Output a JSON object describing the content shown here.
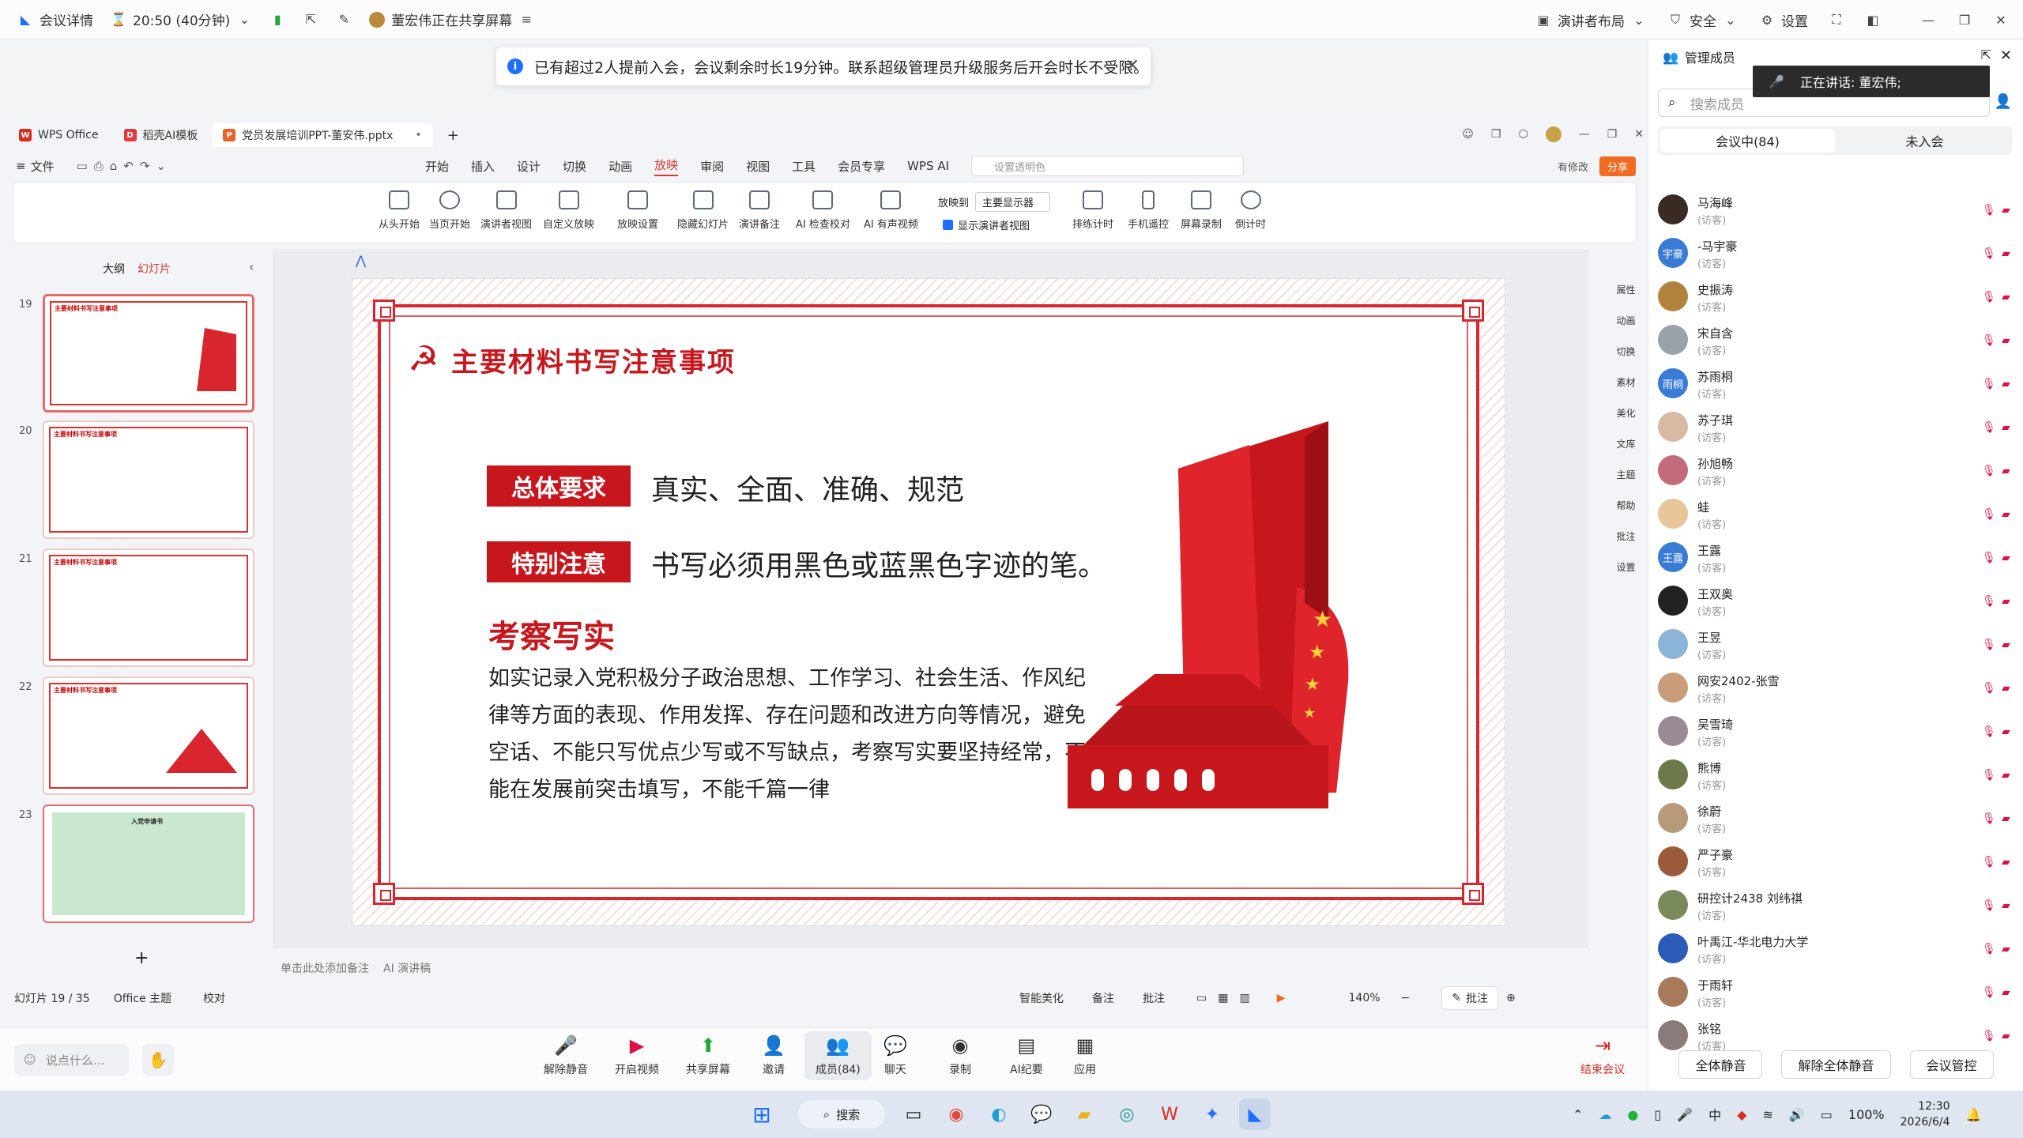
{
  "topbar": {
    "meeting_details": "会议详情",
    "timer": "20:50 (40分钟)",
    "sharing": "董宏伟正在共享屏幕",
    "presenter_layout": "演讲者布局",
    "security": "安全",
    "settings": "设置"
  },
  "notice": "已有超过2人提前入会，会议剩余时长19分钟。联系超级管理员升级服务后开会时长不受限。",
  "wps": {
    "tabs": [
      "WPS Office",
      "稻壳AI模板",
      "党员发展培训PPT-董安伟.pptx"
    ],
    "menu": [
      "开始",
      "插入",
      "设计",
      "切换",
      "动画",
      "放映",
      "审阅",
      "视图",
      "工具",
      "会员专享",
      "WPS AI"
    ],
    "active_menu": "放映",
    "file": "文件",
    "search_placeholder": "设置透明色",
    "edit_status": "有修改",
    "share": "分享",
    "ribbon": [
      "从头开始",
      "当页开始",
      "演讲者视图",
      "自定义放映",
      "放映设置",
      "隐藏幻灯片",
      "演讲备注",
      "AI 检查校对",
      "AI 有声视频",
      "排练计时",
      "手机遥控",
      "屏幕录制",
      "倒计时"
    ],
    "play_to": "放映到",
    "monitor": "主要显示器",
    "show_presenter": "显示演讲者视图",
    "outline": "大纲",
    "slides_tab": "幻灯片",
    "side_tools": [
      "属性",
      "动画",
      "切换",
      "素材",
      "美化",
      "文库",
      "主题",
      "帮助",
      "批注",
      "设置"
    ]
  },
  "thumbnails": [
    {
      "num": "19",
      "title": "主要材料书写注意事项"
    },
    {
      "num": "20",
      "title": "主要材料书写注意事项"
    },
    {
      "num": "21",
      "title": "主要材料书写注意事项"
    },
    {
      "num": "22",
      "title": "主要材料书写注意事项"
    },
    {
      "num": "23",
      "title": "入党申请书"
    }
  ],
  "slide": {
    "title": "主要材料书写注意事项",
    "tag1": "总体要求",
    "text1": "真实、全面、准确、规范",
    "tag2": "特别注意",
    "text2": "书写必须用黑色或蓝黑色字迹的笔。",
    "subtitle": "考察写实",
    "body": "如实记录入党积极分子政治思想、工作学习、社会生活、作风纪律等方面的表现、作用发挥、存在问题和改进方向等情况，避免空话、不能只写优点少写或不写缺点，考察写实要坚持经常，不能在发展前突击填写，不能千篇一律"
  },
  "notes": {
    "placeholder": "单击此处添加备注",
    "ai": "AI 演讲稿"
  },
  "status": {
    "slide": "幻灯片 19 / 35",
    "theme": "Office 主题",
    "proof": "校对",
    "beautify": "智能美化",
    "notes": "备注",
    "comments": "批注",
    "zoom": "140%",
    "annotate": "批注"
  },
  "panel": {
    "title": "管理成员",
    "speaking": "正在讲话:  董宏伟;",
    "search_placeholder": "搜索成员",
    "tab_in": "会议中(84)",
    "tab_out": "未入会",
    "guest": "(访客)",
    "members": [
      {
        "name": "马海峰",
        "color": "#3a2a24"
      },
      {
        "name": "-马宇豪",
        "color": "#3a7bd5",
        "initials": "宇豪"
      },
      {
        "name": "史振涛",
        "color": "#b0823e"
      },
      {
        "name": "宋自含",
        "color": "#9aa1a8"
      },
      {
        "name": "苏雨桐",
        "color": "#3a7bd5",
        "initials": "雨桐"
      },
      {
        "name": "苏子琪",
        "color": "#d8b9a4"
      },
      {
        "name": "孙旭畅",
        "color": "#c36b7a"
      },
      {
        "name": "蛙",
        "color": "#e9c59a"
      },
      {
        "name": "王露",
        "color": "#3a7bd5",
        "initials": "王露"
      },
      {
        "name": "王双奥",
        "color": "#222"
      },
      {
        "name": "王昱",
        "color": "#8bb4d8"
      },
      {
        "name": "网安2402-张雪",
        "color": "#c99c7a"
      },
      {
        "name": "吴雪琦",
        "color": "#9a8a96"
      },
      {
        "name": "熊博",
        "color": "#6c7a4a"
      },
      {
        "name": "徐蔚",
        "color": "#b79a7a"
      },
      {
        "name": "严子豪",
        "color": "#9b5a3a"
      },
      {
        "name": "研控计2438 刘纬祺",
        "color": "#7a8a5a"
      },
      {
        "name": "叶禹江-华北电力大学",
        "color": "#2a5cb8"
      },
      {
        "name": "于雨轩",
        "color": "#a67a5a"
      },
      {
        "name": "张铭",
        "color": "#8a7a7a"
      }
    ],
    "mute_all": "全体静音",
    "unmute_all": "解除全体静音",
    "control": "会议管控"
  },
  "bottom": {
    "chat_placeholder": "说点什么...",
    "buttons": [
      "解除静音",
      "开启视频",
      "共享屏幕",
      "邀请",
      "成员(84)",
      "聊天",
      "录制",
      "AI纪要",
      "应用"
    ],
    "end": "结束会议"
  },
  "taskbar": {
    "search": "搜索",
    "ime": "中",
    "battery": "100%",
    "time": "12:30",
    "date": "2026/6/4"
  }
}
